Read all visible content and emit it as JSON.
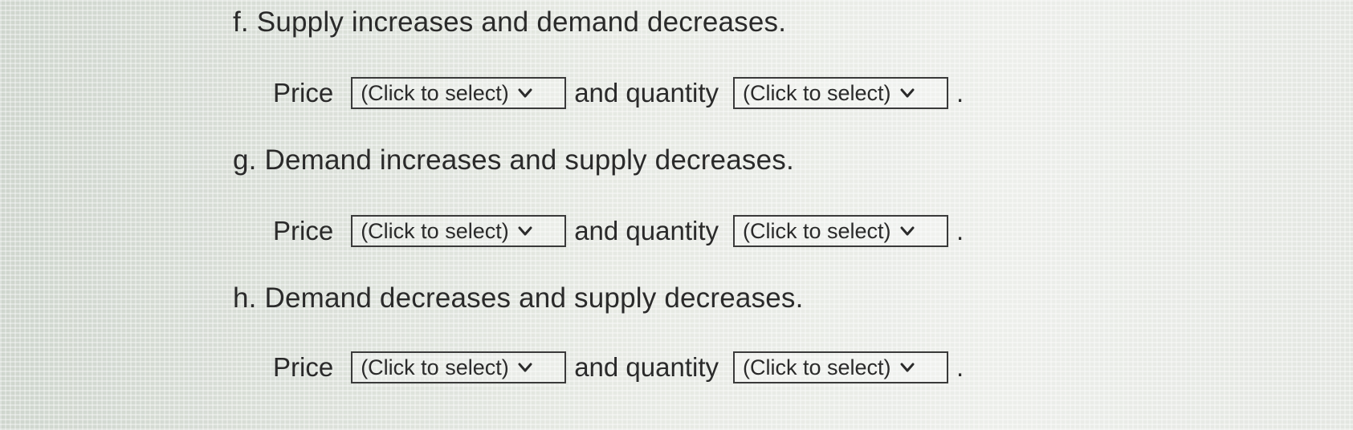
{
  "questions": [
    {
      "heading": "f. Supply increases and demand decreases.",
      "price_label": "Price",
      "price_select": "(Click to select)",
      "and_label": "and quantity",
      "quantity_select": "(Click to select)",
      "end": "."
    },
    {
      "heading": "g. Demand increases and supply decreases.",
      "price_label": "Price",
      "price_select": "(Click to select)",
      "and_label": "and quantity",
      "quantity_select": "(Click to select)",
      "end": "."
    },
    {
      "heading": "h. Demand decreases and supply decreases.",
      "price_label": "Price",
      "price_select": "(Click to select)",
      "and_label": "and quantity",
      "quantity_select": "(Click to select)",
      "end": "."
    }
  ],
  "icons": {
    "dropdown": "chevron-down-icon"
  }
}
